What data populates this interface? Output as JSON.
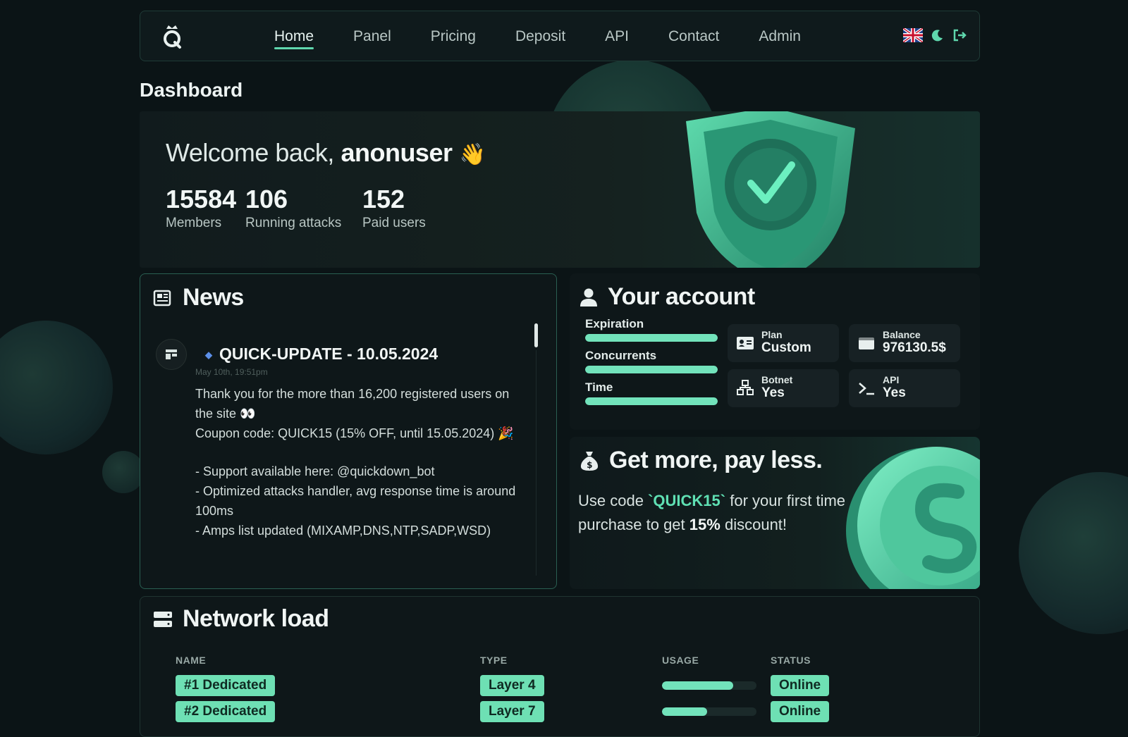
{
  "nav": {
    "items": [
      {
        "label": "Home",
        "active": true
      },
      {
        "label": "Panel",
        "active": false
      },
      {
        "label": "Pricing",
        "active": false
      },
      {
        "label": "Deposit",
        "active": false
      },
      {
        "label": "API",
        "active": false
      },
      {
        "label": "Contact",
        "active": false
      },
      {
        "label": "Admin",
        "active": false
      }
    ],
    "icons": [
      "uk-flag-icon",
      "moon-icon",
      "logout-icon"
    ]
  },
  "page": {
    "title": "Dashboard"
  },
  "hero": {
    "welcome_prefix": "Welcome back,",
    "username": "anonuser",
    "wave": "👋",
    "stats": [
      {
        "value": "15584",
        "label": "Members"
      },
      {
        "value": "106",
        "label": "Running attacks"
      },
      {
        "value": "152",
        "label": "Paid users"
      }
    ]
  },
  "news": {
    "title": "News",
    "post": {
      "title": "QUICK-UPDATE - 10.05.2024",
      "date": "May 10th, 19:51pm",
      "lines": [
        "Thank you for the more than 16,200 registered users on the site 👀",
        "Coupon code: QUICK15 (15% OFF, until 15.05.2024) 🎉",
        "- Support available here: @quickdown_bot",
        "- Optimized attacks handler, avg response time is around 100ms",
        "- Amps list updated (MIXAMP,DNS,NTP,SADP,WSD)"
      ]
    }
  },
  "account": {
    "title": "Your account",
    "meters": [
      {
        "label": "Expiration",
        "value": 1.0
      },
      {
        "label": "Concurrents",
        "value": 1.0
      },
      {
        "label": "Time",
        "value": 1.0
      }
    ],
    "tiles": [
      {
        "label": "Plan",
        "value": "Custom",
        "icon": "id-card-icon"
      },
      {
        "label": "Balance",
        "value": "976130.5$",
        "icon": "wallet-icon"
      },
      {
        "label": "Botnet",
        "value": "Yes",
        "icon": "network-nodes-icon"
      },
      {
        "label": "API",
        "value": "Yes",
        "icon": "terminal-icon"
      }
    ]
  },
  "promo": {
    "title": "Get more, pay less.",
    "text_prefix": "Use code",
    "code": "`QUICK15`",
    "text_mid": "for your first time purchase to get",
    "discount": "15%",
    "text_suffix": "discount!"
  },
  "network": {
    "title": "Network load",
    "columns": [
      "NAME",
      "TYPE",
      "USAGE",
      "STATUS"
    ],
    "rows": [
      {
        "name": "#1 Dedicated",
        "type": "Layer 4",
        "usage": 0.75,
        "status": "Online"
      },
      {
        "name": "#2 Dedicated",
        "type": "Layer 7",
        "usage": 0.48,
        "status": "Online"
      }
    ]
  },
  "colors": {
    "accent": "#6ee0b4",
    "background": "#0b1416",
    "card": "#0e1719"
  }
}
